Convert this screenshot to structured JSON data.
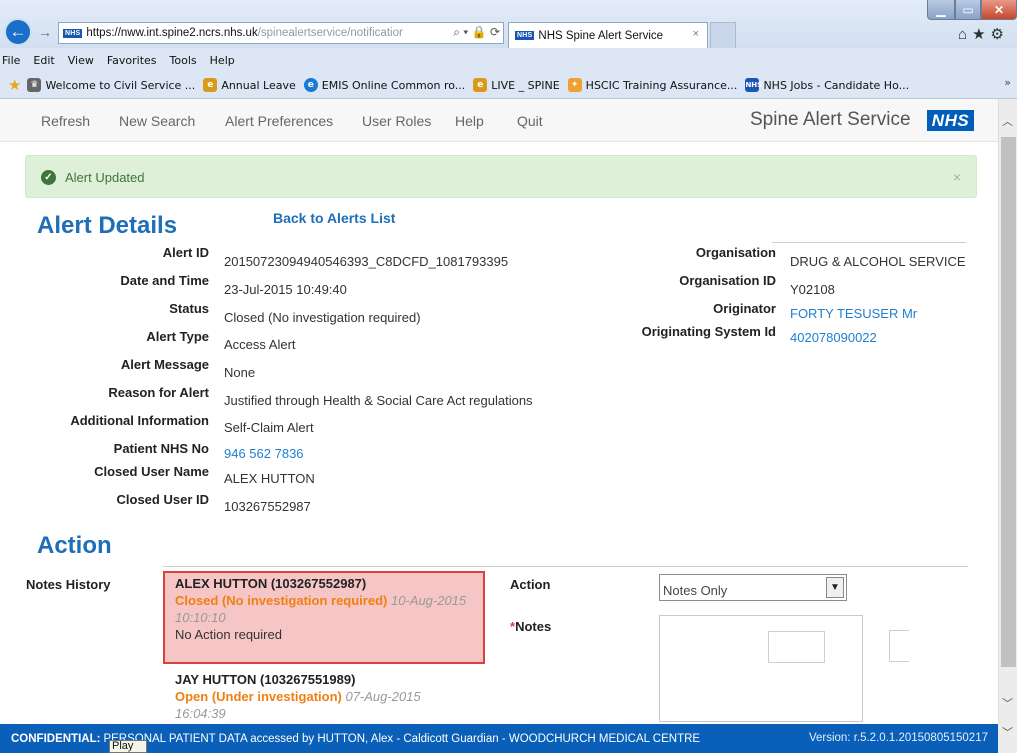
{
  "browser": {
    "url_host": "https://nww.int.spine2.ncrs.nhs.uk",
    "url_rest": "/spinealertservice/notificatior",
    "address_tools": "⌕ ▾ 🔒 ⟳",
    "tab_title": "NHS Spine Alert Service",
    "tab_close": "×",
    "favicon_label": "NHS",
    "menu": [
      "File",
      "Edit",
      "View",
      "Favorites",
      "Tools",
      "Help"
    ],
    "favorites": [
      {
        "label": "Welcome to Civil Service ...",
        "icon": "crest-icon",
        "color": "#555555"
      },
      {
        "label": "Annual Leave",
        "icon": "ie-page-icon",
        "color": "#e0a020"
      },
      {
        "label": "EMIS Online Common ro...",
        "icon": "ie-e-icon",
        "color": "#1a7ad4"
      },
      {
        "label": "LIVE _ SPINE",
        "icon": "ie-page-icon",
        "color": "#e0a020"
      },
      {
        "label": "HSCIC Training Assurance...",
        "icon": "hscic-icon",
        "color": "#f0a030"
      },
      {
        "label": "NHS Jobs - Candidate Ho...",
        "icon": "nhs-icon",
        "color": "#1a56b4"
      }
    ],
    "fav_more": "»"
  },
  "app": {
    "nav": [
      "Refresh",
      "New Search",
      "Alert Preferences",
      "User Roles",
      "Help",
      "Quit"
    ],
    "service_title": "Spine Alert Service",
    "nhs_logo": "NHS",
    "alert_message": "Alert Updated",
    "alert_close": "×",
    "alert_color": "#3c763d"
  },
  "details": {
    "heading": "Alert Details",
    "back_link": "Back to Alerts List",
    "left": [
      {
        "label": "Alert ID",
        "value": "20150723094940546393_C8DCFD_1081793395"
      },
      {
        "label": "Date and Time",
        "value": "23-Jul-2015 10:49:40"
      },
      {
        "label": "Status",
        "value": "Closed (No investigation required)"
      },
      {
        "label": "Alert Type",
        "value": "Access Alert"
      },
      {
        "label": "Alert Message",
        "value": "None"
      },
      {
        "label": "Reason for Alert",
        "value": "Justified through Health & Social Care Act regulations"
      },
      {
        "label": "Additional Information",
        "value": "Self-Claim Alert"
      },
      {
        "label": "Patient NHS No",
        "value": "946 562 7836"
      },
      {
        "label": "Closed User Name",
        "value": "ALEX HUTTON"
      },
      {
        "label": "Closed User ID",
        "value": "103267552987"
      }
    ],
    "right": [
      {
        "label": "Organisation",
        "value": "DRUG & ALCOHOL SERVICE"
      },
      {
        "label": "Organisation ID",
        "value": "Y02108"
      },
      {
        "label": "Originator",
        "value": "FORTY TESUSER Mr"
      },
      {
        "label": "Originating System Id",
        "value": "402078090022"
      }
    ]
  },
  "action": {
    "heading": "Action",
    "notes_history_label": "Notes History",
    "notes": [
      {
        "name": "ALEX HUTTON (103267552987)",
        "status": "Closed (No investigation required)",
        "date": "10-Aug-2015 10:10:10",
        "text": "No Action required"
      },
      {
        "name": "JAY HUTTON (103267551989)",
        "status": "Open (Under investigation)",
        "date": "07-Aug-2015 16:04:39",
        "text": ""
      }
    ],
    "action_label": "Action",
    "notes_label": "Notes",
    "required_mark": "*",
    "selected_action": "Notes Only"
  },
  "footer": {
    "confidential": "CONFIDENTIAL:",
    "text": "PERSONAL PATIENT DATA accessed by HUTTON, Alex - Caldicott Guardian - WOODCHURCH MEDICAL CENTRE",
    "version": "Version: r.5.2.0.1.20150805150217",
    "tooltip": "Play"
  }
}
